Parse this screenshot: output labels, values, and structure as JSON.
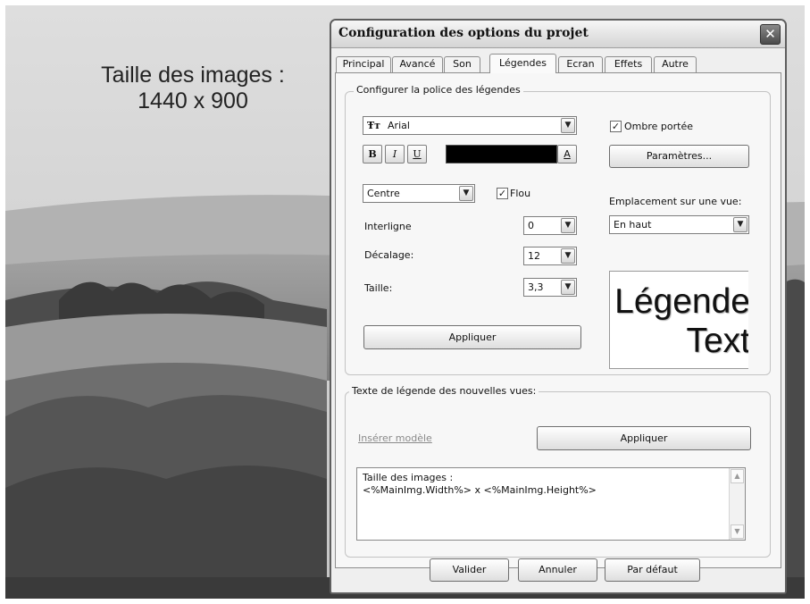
{
  "background": {
    "overlay_text": [
      "Taille des images :",
      "1440 x 900"
    ]
  },
  "dialog": {
    "title": "Configuration des options du projet",
    "close_glyph": "✕",
    "tabs": [
      {
        "label": "Principal"
      },
      {
        "label": "Avancé"
      },
      {
        "label": "Son"
      },
      {
        "label": "Légendes",
        "active": true
      },
      {
        "label": "Ecran"
      },
      {
        "label": "Effets"
      },
      {
        "label": "Autre"
      }
    ],
    "font_group": {
      "label": "Configurer la police des légendes",
      "font_icon": "Ŧт",
      "font_name": "Arial",
      "bold_glyph": "B",
      "italic_glyph": "I",
      "underline_glyph": "U",
      "text_color_glyph": "A",
      "text_color": "#000000",
      "shadow_label": "Ombre portée",
      "shadow_checked": true,
      "params_button": "Paramètres...",
      "align_value": "Centre",
      "blur_label": "Flou",
      "blur_checked": true,
      "position_label": "Emplacement sur une vue:",
      "position_value": "En haut",
      "line_spacing_label": "Interligne",
      "line_spacing_value": "0",
      "offset_label": "Décalage:",
      "offset_value": "12",
      "size_label": "Taille:",
      "size_value": "3,3",
      "apply_button": "Appliquer",
      "preview_line1": "Légende",
      "preview_line2": "Text"
    },
    "caption_group": {
      "label": "Texte de légende des nouvelles vues:",
      "insert_template": "Insérer modèle",
      "apply_button": "Appliquer",
      "text_line1": "Taille des images :",
      "text_line2": "<%MainImg.Width%> x <%MainImg.Height%>"
    },
    "footer": {
      "ok": "Valider",
      "cancel": "Annuler",
      "default": "Par défaut"
    }
  }
}
